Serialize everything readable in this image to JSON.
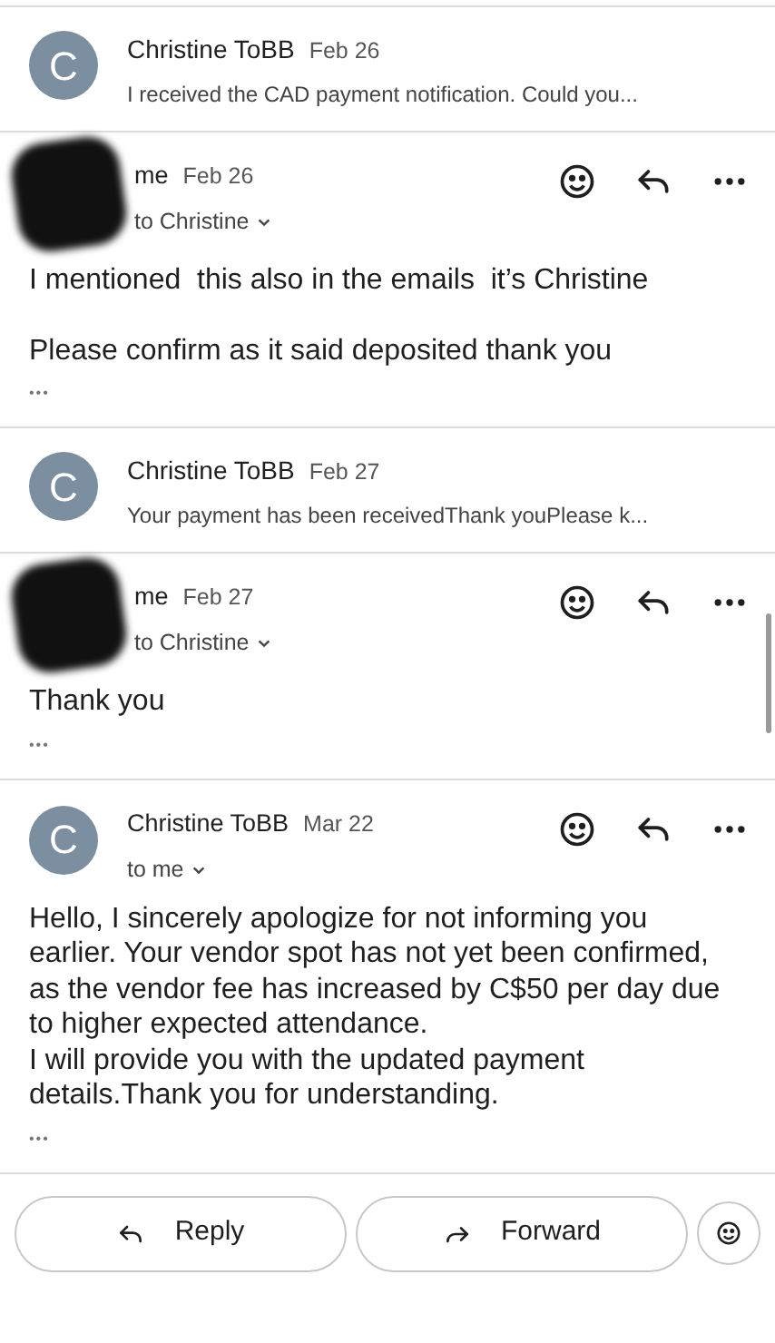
{
  "messages": [
    {
      "kind": "collapsed",
      "avatar": {
        "kind": "letter",
        "letter": "C"
      },
      "sender": "Christine ToBB",
      "date": "Feb 26",
      "snippet": "I received the CAD payment notification. Could you..."
    },
    {
      "kind": "expanded",
      "avatar": {
        "kind": "redacted"
      },
      "sender": "me",
      "date": "Feb 26",
      "recipient": "to Christine",
      "body": [
        [
          "I mentioned  this also in the emails  it’s Christine"
        ],
        [
          "Please confirm as it said deposited thank you"
        ]
      ],
      "more": "•••"
    },
    {
      "kind": "collapsed",
      "avatar": {
        "kind": "letter",
        "letter": "C"
      },
      "sender": "Christine ToBB",
      "date": "Feb 27",
      "snippet": "Your payment has been receivedThank youPlease k..."
    },
    {
      "kind": "expanded",
      "avatar": {
        "kind": "redacted"
      },
      "sender": "me",
      "date": "Feb 27",
      "recipient": "to Christine",
      "body": [
        [
          "Thank you"
        ]
      ],
      "more": "•••"
    },
    {
      "kind": "expanded",
      "avatar": {
        "kind": "letter",
        "letter": "C"
      },
      "sender": "Christine ToBB",
      "date": "Mar 22",
      "recipient": "to me",
      "body": [
        [
          "Hello, I sincerely apologize for not informing you earlier. Your vendor spot has not yet been confirmed, as the vendor fee has increased by C$50 per day due to higher expected attendance.",
          "I will provide you with the updated payment details.Thank you for understanding."
        ]
      ],
      "more": "•••"
    }
  ],
  "actions": [
    {
      "kind": "reply",
      "label": "Reply"
    },
    {
      "kind": "forward",
      "label": "Forward"
    },
    {
      "kind": "emoji"
    }
  ]
}
